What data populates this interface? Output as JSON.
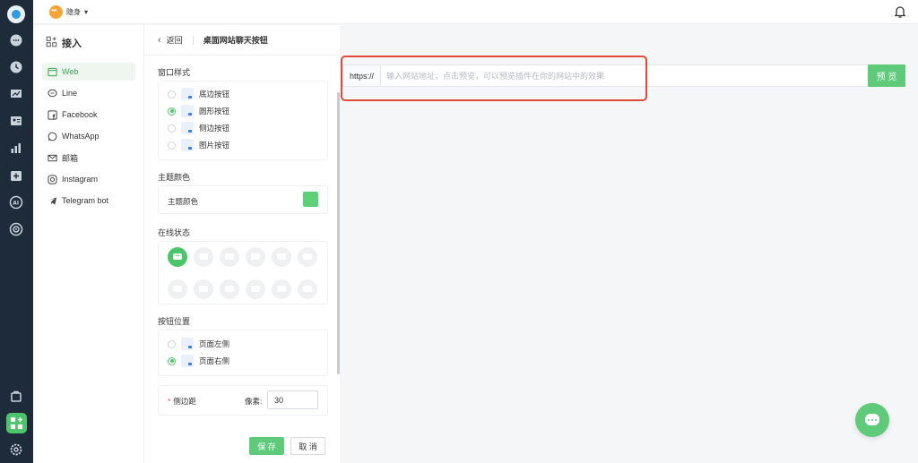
{
  "topbar": {
    "status_label": "隐身",
    "status_caret": "▾"
  },
  "nav": {
    "title": "接入",
    "items": [
      {
        "label": "Web",
        "icon": "web-window-icon",
        "active": true
      },
      {
        "label": "Line",
        "icon": "line-icon",
        "active": false
      },
      {
        "label": "Facebook",
        "icon": "facebook-icon",
        "active": false
      },
      {
        "label": "WhatsApp",
        "icon": "whatsapp-icon",
        "active": false
      },
      {
        "label": "邮箱",
        "icon": "mail-icon",
        "active": false
      },
      {
        "label": "Instagram",
        "icon": "instagram-icon",
        "active": false
      },
      {
        "label": "Telegram bot",
        "icon": "telegram-icon",
        "active": false
      }
    ]
  },
  "panel": {
    "back_label": "返回",
    "page_title": "桌面网站聊天按钮",
    "window_style_title": "窗口样式",
    "window_styles": [
      {
        "label": "底边按钮",
        "selected": false
      },
      {
        "label": "圆形按钮",
        "selected": true
      },
      {
        "label": "侧边按钮",
        "selected": false
      },
      {
        "label": "图片按钮",
        "selected": false
      }
    ],
    "theme_color_title": "主题颜色",
    "theme_color_label": "主题颜色",
    "theme_color_value": "#5fd07a",
    "online_status_title": "在线状态",
    "button_position_title": "按钮位置",
    "positions": [
      {
        "label": "页面左侧",
        "selected": false
      },
      {
        "label": "页面右侧",
        "selected": true
      }
    ],
    "side_margin_label": "侧边距",
    "pixel_label": "像素:",
    "side_margin_value": "30",
    "save_label": "保 存",
    "cancel_label": "取 消"
  },
  "preview": {
    "url_prefix": "https://",
    "url_placeholder": "输入网站地址，点击预览，可以预览插件在你的网站中的效果",
    "preview_button": "预 览"
  },
  "colors": {
    "accent": "#4cc46a",
    "rail": "#1d2b3a",
    "highlight": "#e04a3a"
  }
}
